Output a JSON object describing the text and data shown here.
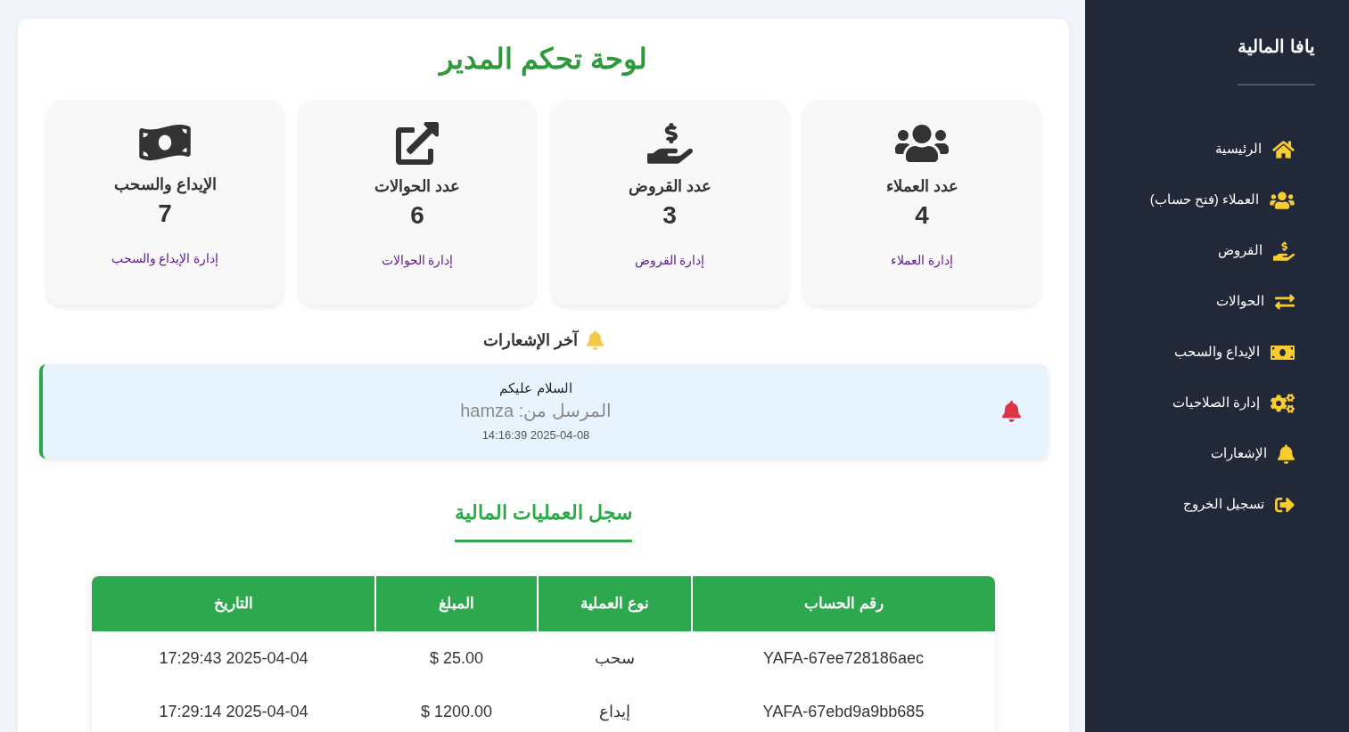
{
  "sidebar": {
    "title": "يافا المالية",
    "items": [
      "الرئيسية",
      "العملاء (فتح حساب)",
      "القروض",
      "الحوالات",
      "الإيداع والسحب",
      "إدارة الصلاحيات",
      "الإشعارات",
      "تسجيل الخروج"
    ]
  },
  "main": {
    "title": "لوحة تحكم المدير",
    "stat_cards": [
      {
        "title": "عدد العملاء",
        "value": "4",
        "link": "إدارة العملاء"
      },
      {
        "title": "عدد القروض",
        "value": "3",
        "link": "إدارة القروض"
      },
      {
        "title": "عدد الحوالات",
        "value": "6",
        "link": "إدارة الحوالات"
      },
      {
        "title": "الإيداع والسحب",
        "value": "7",
        "link": "إدارة الإيداع والسحب"
      }
    ],
    "notifications": {
      "heading": "آخر الإشعارات",
      "items": [
        {
          "message": "السلام عليكم",
          "sender": "المرسل من: hamza",
          "time": "14:16:39 2025-04-08"
        }
      ]
    },
    "transactions": {
      "title": "سجل العمليات المالية",
      "columns": [
        "رقم الحساب",
        "نوع العملية",
        "المبلغ",
        "التاريخ"
      ],
      "rows": [
        [
          "YAFA-67ee728186aec",
          "سحب",
          "$ 25.00",
          "17:29:43 2025-04-04"
        ],
        [
          "YAFA-67ebd9a9bb685",
          "إيداع",
          "$ 1200.00",
          "17:29:14 2025-04-04"
        ]
      ]
    }
  }
}
